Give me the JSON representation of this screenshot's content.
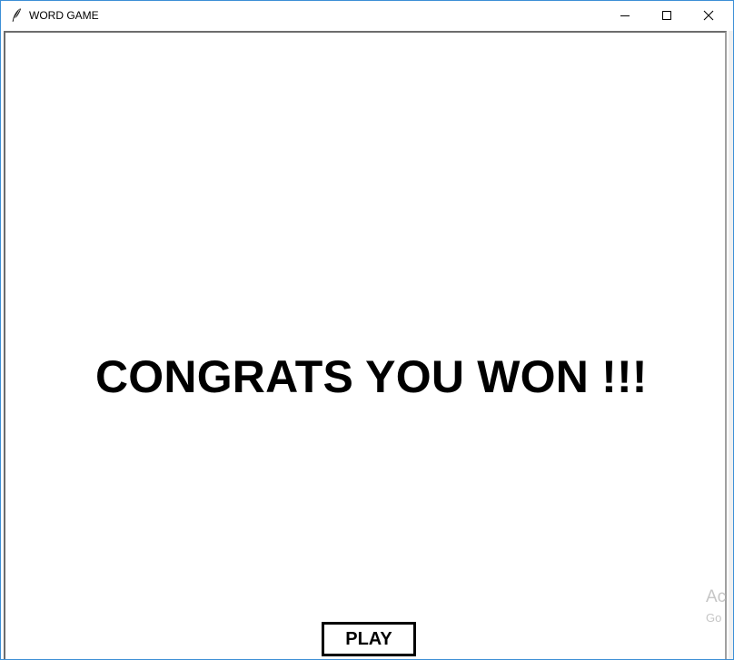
{
  "window": {
    "title": "WORD GAME",
    "icons": {
      "app": "feather-icon",
      "minimize": "minimize-icon",
      "maximize": "maximize-icon",
      "close": "close-icon"
    }
  },
  "main": {
    "message": "CONGRATS YOU WON !!!",
    "play_label": "PLAY"
  },
  "watermark": {
    "line1": "Ac",
    "line2": "Go"
  },
  "colors": {
    "window_border": "#3c8fd6",
    "background": "#ffffff",
    "text": "#000000",
    "watermark": "#c6c6c6"
  }
}
